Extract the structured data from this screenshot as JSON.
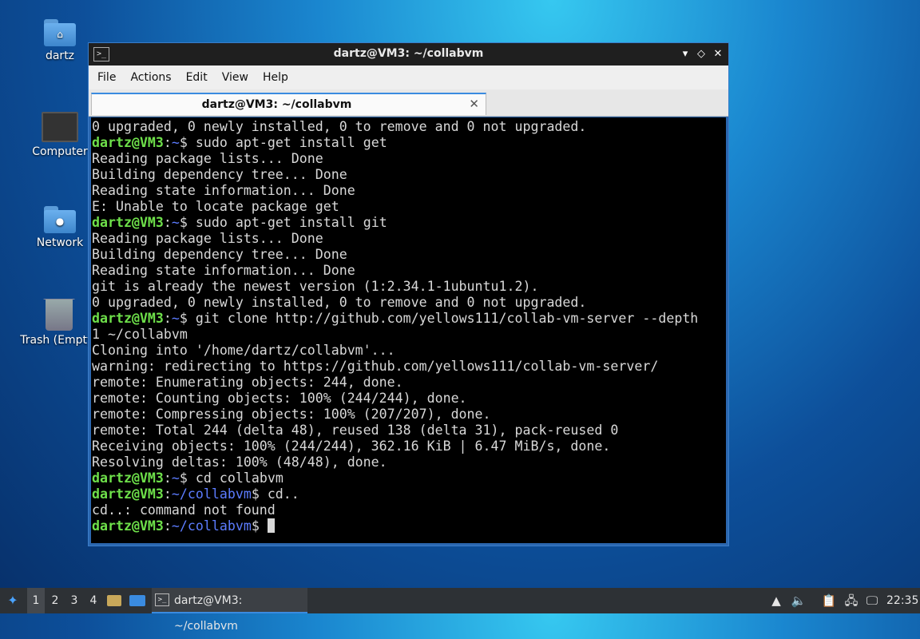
{
  "desktop": {
    "icons": [
      {
        "label": "dartz"
      },
      {
        "label": "Computer"
      },
      {
        "label": "Network"
      },
      {
        "label": "Trash (Empty)"
      }
    ]
  },
  "window": {
    "title": "dartz@VM3: ~/collabvm",
    "controls": {
      "minimize": "▾",
      "maximize": "◇",
      "close": "✕"
    },
    "menu": [
      "File",
      "Actions",
      "Edit",
      "View",
      "Help"
    ],
    "tab": {
      "label": "dartz@VM3: ~/collabvm",
      "close": "✕"
    }
  },
  "terminal": {
    "prompt_user": "dartz@VM3",
    "lines": [
      {
        "t": "0 upgraded, 0 newly installed, 0 to remove and 0 not upgraded."
      },
      {
        "path": "~",
        "cmd": " sudo apt-get install get"
      },
      {
        "t": "Reading package lists... Done"
      },
      {
        "t": "Building dependency tree... Done"
      },
      {
        "t": "Reading state information... Done"
      },
      {
        "t": "E: Unable to locate package get"
      },
      {
        "path": "~",
        "cmd": " sudo apt-get install git"
      },
      {
        "t": "Reading package lists... Done"
      },
      {
        "t": "Building dependency tree... Done"
      },
      {
        "t": "Reading state information... Done"
      },
      {
        "t": "git is already the newest version (1:2.34.1-1ubuntu1.2)."
      },
      {
        "t": "0 upgraded, 0 newly installed, 0 to remove and 0 not upgraded."
      },
      {
        "path": "~",
        "cmd": " git clone http://github.com/yellows111/collab-vm-server --depth"
      },
      {
        "t": "1 ~/collabvm"
      },
      {
        "t": "Cloning into '/home/dartz/collabvm'..."
      },
      {
        "t": "warning: redirecting to https://github.com/yellows111/collab-vm-server/"
      },
      {
        "t": "remote: Enumerating objects: 244, done."
      },
      {
        "t": "remote: Counting objects: 100% (244/244), done."
      },
      {
        "t": "remote: Compressing objects: 100% (207/207), done."
      },
      {
        "t": "remote: Total 244 (delta 48), reused 138 (delta 31), pack-reused 0"
      },
      {
        "t": "Receiving objects: 100% (244/244), 362.16 KiB | 6.47 MiB/s, done."
      },
      {
        "t": "Resolving deltas: 100% (48/48), done."
      },
      {
        "path": "~",
        "cmd": " cd collabvm"
      },
      {
        "path": "~/collabvm",
        "cmd": " cd.."
      },
      {
        "t": "cd..: command not found"
      },
      {
        "path": "~/collabvm",
        "cmd": " ",
        "cursor": true
      }
    ]
  },
  "taskbar": {
    "workspaces": [
      "1",
      "2",
      "3",
      "4"
    ],
    "active_task": "dartz@VM3: ~/collabvm",
    "clock": "22:35"
  }
}
